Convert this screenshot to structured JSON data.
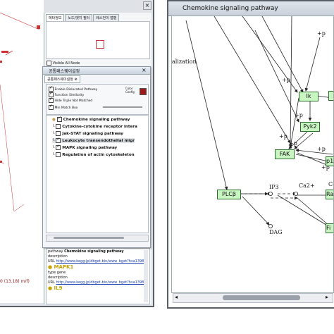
{
  "colors": {
    "gene_fill": "#c9f5c2",
    "gene_border": "#2d6b2d",
    "accent_red": "#a01818"
  },
  "left": {
    "canvas_label": "0 (13.18) m/f)",
    "tabs": [
      "메타정보",
      "노드/엣지 필터",
      "레스전이 맵핑"
    ],
    "visible_all_node": "Visible All Node",
    "dialog": {
      "title": "공통패스웨이설정",
      "tab": "공통패스웨이설정",
      "opt1": "Enable Dislocated Pathway",
      "opt2": "Function Similarity",
      "opt3": "Hide Triple Not Matched",
      "color_label": "Color Config",
      "min_label": "Min Match Box",
      "pathways": [
        {
          "label": "Chemokine signaling pathway",
          "checked": true
        },
        {
          "label": "Cytokine-cytokine receptor intera",
          "checked": false
        },
        {
          "label": "Jak-STAT signaling pathway",
          "checked": false
        },
        {
          "label": "Leukocyte transendothelial migr",
          "checked": true
        },
        {
          "label": "MAPK signaling pathway",
          "checked": true
        },
        {
          "label": "Regulation of actin cytoskeleton",
          "checked": false
        }
      ]
    },
    "meta": {
      "pathway_key": "pathway",
      "pathway_val": "Chemokine signaling pathway",
      "desc_key": "description",
      "url_key": "URL",
      "url_val": "http://www.kegg.jp/dbget-bin/www_bget?hsa1398",
      "gene1": "MAPK1",
      "type_key": "type",
      "type_val": "gene",
      "gene2": "IL9"
    }
  },
  "right": {
    "title": "Chemokine signaling pathway",
    "genes": [
      "Ik",
      "Pyk2",
      "FAK",
      "p13",
      "PLCβ",
      "Ra",
      "Fi"
    ],
    "labels": [
      "+p",
      "+p",
      "+p",
      "+p",
      "+p",
      "+p",
      "+p",
      "IP3",
      "Ca2+",
      "Ca",
      "DAG",
      "alization"
    ]
  }
}
